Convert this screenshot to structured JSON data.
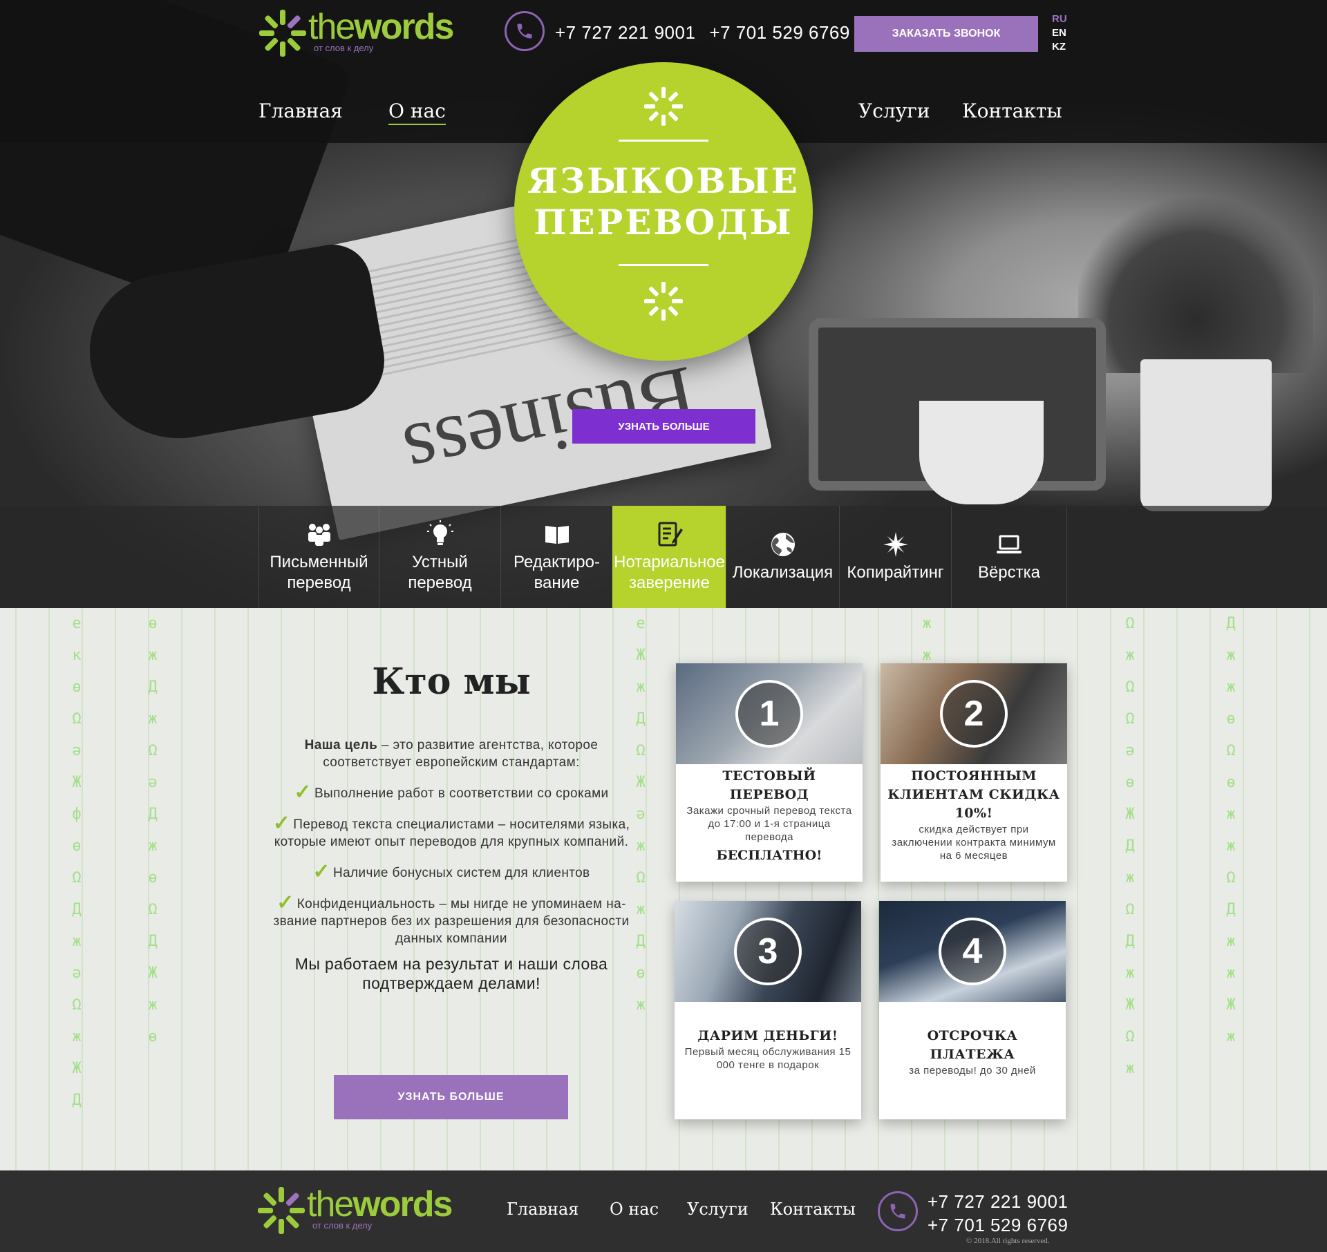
{
  "brand": {
    "name_the": "the",
    "name_words": "words",
    "tagline": "от слов к делу",
    "accent_green": "#b5d22d",
    "accent_purple": "#9a72bb"
  },
  "header": {
    "phones": [
      "+7 727 221 9001",
      "+7 701 529 6769"
    ],
    "callback_label": "ЗАКАЗАТЬ ЗВОНОК",
    "languages": [
      {
        "code": "RU",
        "active": true
      },
      {
        "code": "EN"
      },
      {
        "code": "KZ"
      }
    ]
  },
  "nav": {
    "items": [
      "Главная",
      "О нас",
      "Услуги",
      "Контакты"
    ],
    "active": "О нас"
  },
  "hero": {
    "title_line1": "ЯЗЫКОВЫЕ",
    "title_line2": "ПЕРЕВОДЫ",
    "more_label": "УЗНАТЬ БОЛЬШЕ",
    "paper_word": "Business"
  },
  "services": [
    {
      "label": "Письменный\nперевод",
      "icon": "people-icon"
    },
    {
      "label": "Устный\nперевод",
      "icon": "lightbulb-icon"
    },
    {
      "label": "Редактиро-\nвание",
      "icon": "book-icon"
    },
    {
      "label": "Нотариальное\nзаверение",
      "icon": "document-pen-icon",
      "active": true
    },
    {
      "label": "Локализация",
      "icon": "globe-icon"
    },
    {
      "label": "Копирайтинг",
      "icon": "spark-icon"
    },
    {
      "label": "Вёрстка",
      "icon": "laptop-icon"
    }
  ],
  "about": {
    "title": "Кто мы",
    "goal_bold": "Наша цель",
    "goal_text": " – это развитие агентства, которое соответствует европейским стандартам:",
    "points": [
      "Выполнение работ в соответствии со сроками",
      "Перевод текста специалистами – носителями языка, которые имеют опыт переводов для крупных компаний.",
      "Наличие бонусных систем для клиентов",
      "Конфиденциальность – мы нигде не упоминаем на-звание партнеров без их разрешения для безопасности данных компании"
    ],
    "final": "Мы работаем на результат и наши слова подтверждаем делами!",
    "more_label": "УЗНАТЬ БОЛЬШЕ"
  },
  "cards": [
    {
      "num": "1",
      "title": "ТЕСТОВЫЙ ПЕРЕВОД",
      "desc": "Закажи срочный перевод текста до 17:00 и 1-я страница перевода",
      "bottom": "БЕСПЛАТНО!"
    },
    {
      "num": "2",
      "title": "ПОСТОЯННЫМ КЛИЕНТАМ СКИДКА 10%!",
      "desc": "скидка действует при заключении контракта минимум на 6 месяцев",
      "bottom": ""
    },
    {
      "num": "3",
      "title": "ДАРИМ ДЕНЬГИ!",
      "desc": "Первый месяц обслуживания 15 000 тенге в подарок",
      "bottom": ""
    },
    {
      "num": "4",
      "title": "ОТСРОЧКА ПЛАТЕЖА",
      "desc": "за переводы! до 30 дней",
      "bottom": ""
    }
  ],
  "footer": {
    "nav": [
      "Главная",
      "О нас",
      "Услуги",
      "Контакты"
    ],
    "phones": [
      "+7 727 221 9001",
      "+7 701 529 6769"
    ],
    "copyright": "© 2018.All rights reserved."
  }
}
